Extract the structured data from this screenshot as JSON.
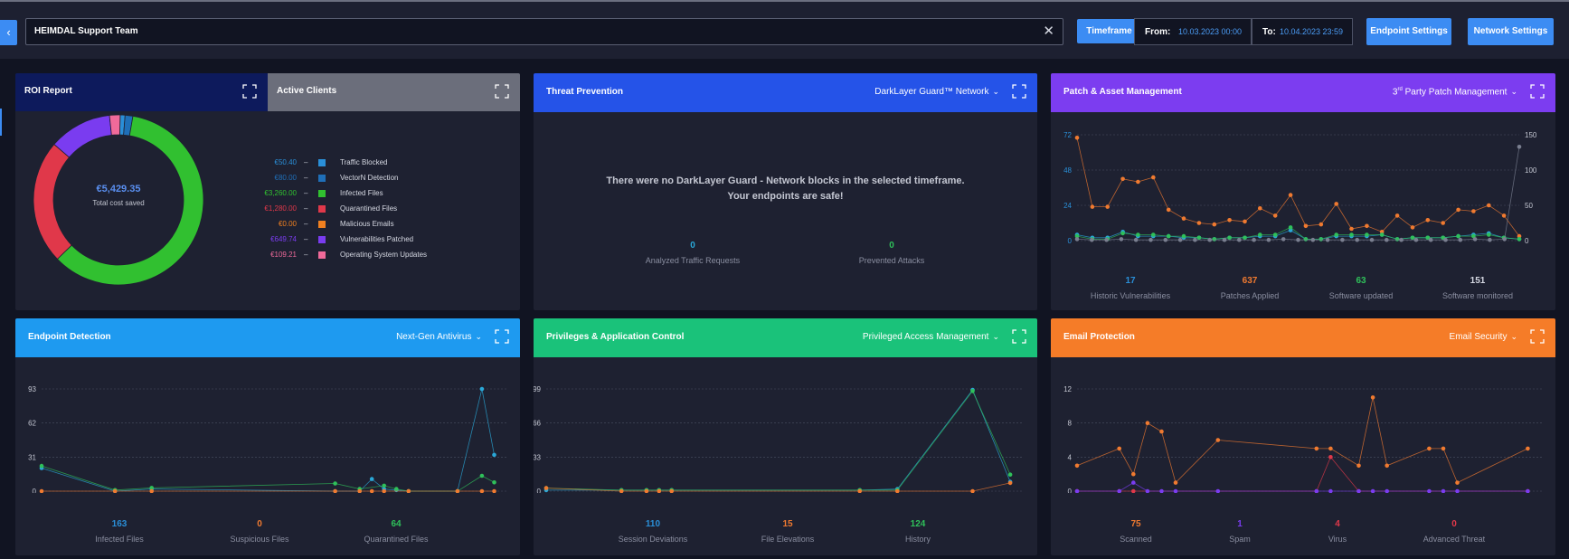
{
  "topbar": {
    "team": "HEIMDAL Support Team",
    "timeframe_label": "Timeframe",
    "from_label": "From:",
    "from_value": "10.03.2023 00:00",
    "to_label": "To:",
    "to_value": "10.04.2023 23:59",
    "endpoint_settings": "Endpoint Settings",
    "network_settings": "Network Settings",
    "back_icon": "chevron-left-icon",
    "clear_icon": "close-icon"
  },
  "roi": {
    "tab1": "ROI Report",
    "tab2": "Active Clients",
    "total": "€5,429.35",
    "total_label": "Total cost saved",
    "legend": [
      {
        "amount": "€50.40",
        "name": "Traffic Blocked",
        "color": "#2a8fd8",
        "value": 50.4
      },
      {
        "amount": "€80.00",
        "name": "VectorN Detection",
        "color": "#1f6fb8",
        "value": 80.0
      },
      {
        "amount": "€3,260.00",
        "name": "Infected Files",
        "color": "#31c030",
        "value": 3260.0
      },
      {
        "amount": "€1,280.00",
        "name": "Quarantined Files",
        "color": "#e0384a",
        "value": 1280.0
      },
      {
        "amount": "€0.00",
        "name": "Malicious Emails",
        "color": "#f08020",
        "value": 0.0
      },
      {
        "amount": "€649.74",
        "name": "Vulnerabilities Patched",
        "color": "#7a3cf0",
        "value": 649.74
      },
      {
        "amount": "€109.21",
        "name": "Operating System Updates",
        "color": "#f06a9a",
        "value": 109.21
      }
    ]
  },
  "threat": {
    "title": "Threat Prevention",
    "select": "DarkLayer Guard™ Network",
    "message_line1": "There were no DarkLayer Guard - Network blocks in the selected timeframe.",
    "message_line2": "Your endpoints are safe!",
    "stats": [
      {
        "value": "0",
        "label": "Analyzed Traffic Requests",
        "color": "#2aa8d8"
      },
      {
        "value": "0",
        "label": "Prevented Attacks",
        "color": "#2fc05a"
      }
    ]
  },
  "patch": {
    "title": "Patch & Asset Management",
    "select_prefix": "3",
    "select_sup": "rd",
    "select_rest": " Party Patch Management",
    "stats": [
      {
        "value": "17",
        "label": "Historic Vulnerabilities",
        "color": "#2a8fd8"
      },
      {
        "value": "637",
        "label": "Patches Applied",
        "color": "#f07a30"
      },
      {
        "value": "63",
        "label": "Software updated",
        "color": "#2fc05a"
      },
      {
        "value": "151",
        "label": "Software monitored",
        "color": "#d5d8e2"
      }
    ]
  },
  "endpoint": {
    "title": "Endpoint Detection",
    "select": "Next-Gen Antivirus",
    "stats": [
      {
        "value": "163",
        "label": "Infected Files",
        "color": "#2a8fd8"
      },
      {
        "value": "0",
        "label": "Suspicious Files",
        "color": "#f07a30"
      },
      {
        "value": "64",
        "label": "Quarantined Files",
        "color": "#2fc05a"
      }
    ]
  },
  "privileges": {
    "title": "Privileges & Application Control",
    "select": "Privileged Access Management",
    "stats": [
      {
        "value": "110",
        "label": "Session Deviations",
        "color": "#2a8fd8"
      },
      {
        "value": "15",
        "label": "File Elevations",
        "color": "#f07a30"
      },
      {
        "value": "124",
        "label": "History",
        "color": "#2fc05a"
      }
    ]
  },
  "email": {
    "title": "Email Protection",
    "select": "Email Security",
    "stats": [
      {
        "value": "75",
        "label": "Scanned",
        "color": "#f07a30"
      },
      {
        "value": "1",
        "label": "Spam",
        "color": "#7a3cf0"
      },
      {
        "value": "4",
        "label": "Virus",
        "color": "#e0384a"
      },
      {
        "value": "0",
        "label": "Advanced Threat",
        "color": "#e0384a"
      }
    ]
  },
  "chart_data": [
    {
      "type": "pie",
      "id": "roi-donut",
      "categories": [
        "Traffic Blocked",
        "VectorN Detection",
        "Infected Files",
        "Quarantined Files",
        "Malicious Emails",
        "Vulnerabilities Patched",
        "Operating System Updates"
      ],
      "values": [
        50.4,
        80.0,
        3260.0,
        1280.0,
        0.0,
        649.74,
        109.21
      ]
    },
    {
      "type": "line",
      "id": "patch-chart",
      "yticks_left": [
        "72",
        "48",
        "24",
        "0"
      ],
      "yticks_right": [
        "150",
        "100",
        "50",
        "0"
      ],
      "ylim_left": [
        0,
        72
      ],
      "ylim_right": [
        0,
        150
      ],
      "series": [
        {
          "color": "#f07a30",
          "axis": "left",
          "values": [
            70,
            23,
            23,
            42,
            40,
            43,
            21,
            15,
            12,
            11,
            14,
            13,
            22,
            17,
            31,
            10,
            11,
            25,
            8,
            10,
            6,
            17,
            9,
            14,
            12,
            21,
            20,
            24,
            17,
            3
          ]
        },
        {
          "color": "#2aa8d8",
          "axis": "left",
          "values": [
            4,
            2,
            2,
            6,
            3,
            3,
            3,
            2,
            2,
            1,
            2,
            2,
            3,
            3,
            7,
            1,
            1,
            3,
            3,
            3,
            4,
            1,
            2,
            2,
            2,
            3,
            4,
            5,
            2,
            1
          ]
        },
        {
          "color": "#2fc05a",
          "axis": "left",
          "values": [
            3,
            1,
            1,
            5,
            4,
            4,
            3,
            3,
            2,
            1,
            2,
            2,
            4,
            4,
            9,
            1,
            1,
            4,
            4,
            4,
            4,
            1,
            2,
            2,
            2,
            3,
            3,
            4,
            2,
            1
          ]
        },
        {
          "color": "#7a7f90",
          "axis": "right",
          "values": [
            2,
            1,
            1,
            2,
            1,
            1,
            1,
            1,
            1,
            1,
            1,
            1,
            1,
            1,
            2,
            1,
            1,
            1,
            1,
            1,
            1,
            1,
            1,
            1,
            1,
            1,
            1,
            2,
            1,
            2,
            133
          ]
        }
      ]
    },
    {
      "type": "line",
      "id": "endpoint-chart",
      "yticks": [
        "93",
        "62",
        "31",
        "0"
      ],
      "ylim": [
        0,
        93
      ],
      "series": [
        {
          "color": "#2aa8d8",
          "points": [
            [
              0,
              21
            ],
            [
              6,
              0
            ],
            [
              9,
              2
            ],
            [
              24,
              0
            ],
            [
              26,
              0
            ],
            [
              27,
              11
            ],
            [
              28,
              2
            ],
            [
              29,
              1
            ],
            [
              30,
              0
            ],
            [
              34,
              0
            ],
            [
              36,
              93
            ],
            [
              37,
              33
            ]
          ]
        },
        {
          "color": "#2fc05a",
          "points": [
            [
              0,
              23
            ],
            [
              6,
              1
            ],
            [
              9,
              3
            ],
            [
              24,
              7
            ],
            [
              26,
              2
            ],
            [
              28,
              5
            ],
            [
              29,
              2
            ],
            [
              30,
              0
            ],
            [
              34,
              0
            ],
            [
              36,
              14
            ],
            [
              37,
              8
            ]
          ]
        },
        {
          "color": "#f07a30",
          "points": [
            [
              0,
              0
            ],
            [
              6,
              0
            ],
            [
              9,
              0
            ],
            [
              24,
              0
            ],
            [
              26,
              0
            ],
            [
              27,
              0
            ],
            [
              28,
              0
            ],
            [
              30,
              0
            ],
            [
              34,
              0
            ],
            [
              36,
              0
            ],
            [
              37,
              0
            ]
          ]
        }
      ]
    },
    {
      "type": "line",
      "id": "privileges-chart",
      "yticks": [
        "99",
        "66",
        "33",
        "0"
      ],
      "ylim": [
        0,
        99
      ],
      "series": [
        {
          "color": "#2aa8d8",
          "points": [
            [
              0,
              1
            ],
            [
              6,
              1
            ],
            [
              8,
              1
            ],
            [
              9,
              1
            ],
            [
              10,
              1
            ],
            [
              25,
              1
            ],
            [
              28,
              2
            ],
            [
              34,
              98
            ],
            [
              37,
              9
            ]
          ]
        },
        {
          "color": "#2fc05a",
          "points": [
            [
              0,
              3
            ],
            [
              6,
              1
            ],
            [
              8,
              1
            ],
            [
              9,
              1
            ],
            [
              10,
              1
            ],
            [
              25,
              1
            ],
            [
              28,
              1
            ],
            [
              34,
              97
            ],
            [
              37,
              16
            ]
          ]
        },
        {
          "color": "#f07a30",
          "points": [
            [
              0,
              3
            ],
            [
              6,
              0
            ],
            [
              8,
              0
            ],
            [
              9,
              0
            ],
            [
              10,
              0
            ],
            [
              25,
              0
            ],
            [
              28,
              0
            ],
            [
              34,
              0
            ],
            [
              37,
              8
            ]
          ]
        }
      ]
    },
    {
      "type": "line",
      "id": "email-chart",
      "yticks": [
        "12",
        "8",
        "4",
        "0"
      ],
      "ylim": [
        0,
        12
      ],
      "series": [
        {
          "color": "#f07a30",
          "points": [
            [
              0,
              3
            ],
            [
              3,
              5
            ],
            [
              4,
              2
            ],
            [
              5,
              8
            ],
            [
              6,
              7
            ],
            [
              7,
              1
            ],
            [
              10,
              6
            ],
            [
              17,
              5
            ],
            [
              18,
              5
            ],
            [
              20,
              3
            ],
            [
              21,
              11
            ],
            [
              22,
              3
            ],
            [
              25,
              5
            ],
            [
              26,
              5
            ],
            [
              27,
              1
            ],
            [
              32,
              5
            ]
          ]
        },
        {
          "color": "#e0384a",
          "points": [
            [
              0,
              0
            ],
            [
              3,
              0
            ],
            [
              4,
              0
            ],
            [
              17,
              0
            ],
            [
              18,
              4
            ],
            [
              20,
              0
            ],
            [
              32,
              0
            ]
          ]
        },
        {
          "color": "#7a3cf0",
          "points": [
            [
              0,
              0
            ],
            [
              3,
              0
            ],
            [
              4,
              1
            ],
            [
              5,
              0
            ],
            [
              6,
              0
            ],
            [
              7,
              0
            ],
            [
              10,
              0
            ],
            [
              17,
              0
            ],
            [
              18,
              0
            ],
            [
              20,
              0
            ],
            [
              21,
              0
            ],
            [
              22,
              0
            ],
            [
              25,
              0
            ],
            [
              26,
              0
            ],
            [
              27,
              0
            ],
            [
              32,
              0
            ]
          ]
        }
      ]
    }
  ]
}
